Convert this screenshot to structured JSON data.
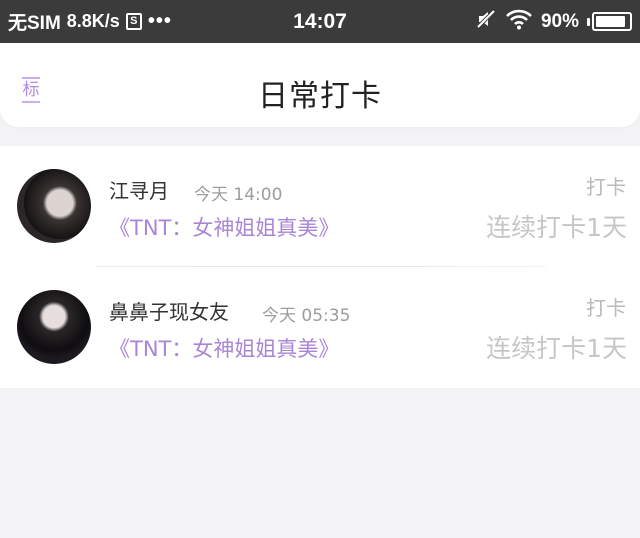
{
  "status_bar": {
    "carrier": "无SIM",
    "speed": "8.8K/s",
    "s_icon_label": "S",
    "dots": "•••",
    "time": "14:07",
    "battery_percent": "90%",
    "battery_level": 0.9,
    "icons": [
      "s-box-icon",
      "more-dots-icon",
      "mute-icon",
      "wifi-icon",
      "battery-icon"
    ]
  },
  "header": {
    "tag": "标",
    "title": "日常打卡"
  },
  "entries": [
    {
      "name": "江寻月",
      "time": "今天 14:00",
      "link": "《TNT：女神姐姐真美》",
      "badge": "打卡",
      "streak": "连续打卡1天"
    },
    {
      "name": "鼻鼻子现女友",
      "time": "今天 05:35",
      "link": "《TNT：女神姐姐真美》",
      "badge": "打卡",
      "streak": "连续打卡1天"
    }
  ],
  "colors": {
    "status_bar_bg": "#3b3b3b",
    "accent": "#a985d6",
    "page_bg": "#f3f3f5"
  }
}
